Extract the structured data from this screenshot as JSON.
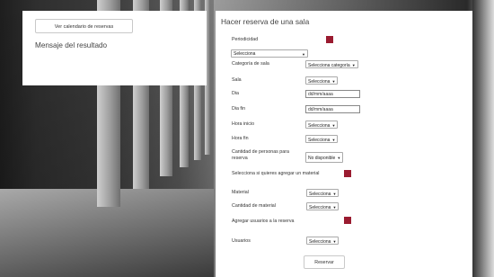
{
  "result_card": {
    "calendar_button": "Ver calendario de reservas",
    "message": "Mensaje del resultado"
  },
  "form": {
    "title": "Hacer reserva de una sala",
    "periodicidad_label": "Periodicidad",
    "periodicidad_select": "Selecciona",
    "categoria_label": "Categoría de sala",
    "categoria_select": "Selecciona categoría",
    "sala_label": "Sala",
    "sala_select": "Selecciona",
    "dia_label": "Dia",
    "dia_placeholder": "dd/mm/aaaa",
    "dia_fin_label": "Dia fin",
    "dia_fin_placeholder": "dd/mm/aaaa",
    "hora_inicio_label": "Hora inicio",
    "hora_inicio_select": "Selecciona",
    "hora_fin_label": "Hora fin",
    "hora_fin_select": "Selecciona",
    "cantidad_personas_label": "Cantidad de personas para reserva",
    "cantidad_personas_select": "No disponible",
    "material_check_label": "Selecciona si quieres agregar un material",
    "material_label": "Material",
    "material_select": "Selecciona",
    "cantidad_material_label": "Cantidad de material",
    "cantidad_material_select": "Selecciona",
    "agregar_usuarios_label": "Agregar usuarios a la reserva",
    "usuarios_label": "Usuarios",
    "usuarios_select": "Selecciona",
    "submit_button": "Reservar"
  },
  "colors": {
    "checkbox": "#9a1b30"
  }
}
